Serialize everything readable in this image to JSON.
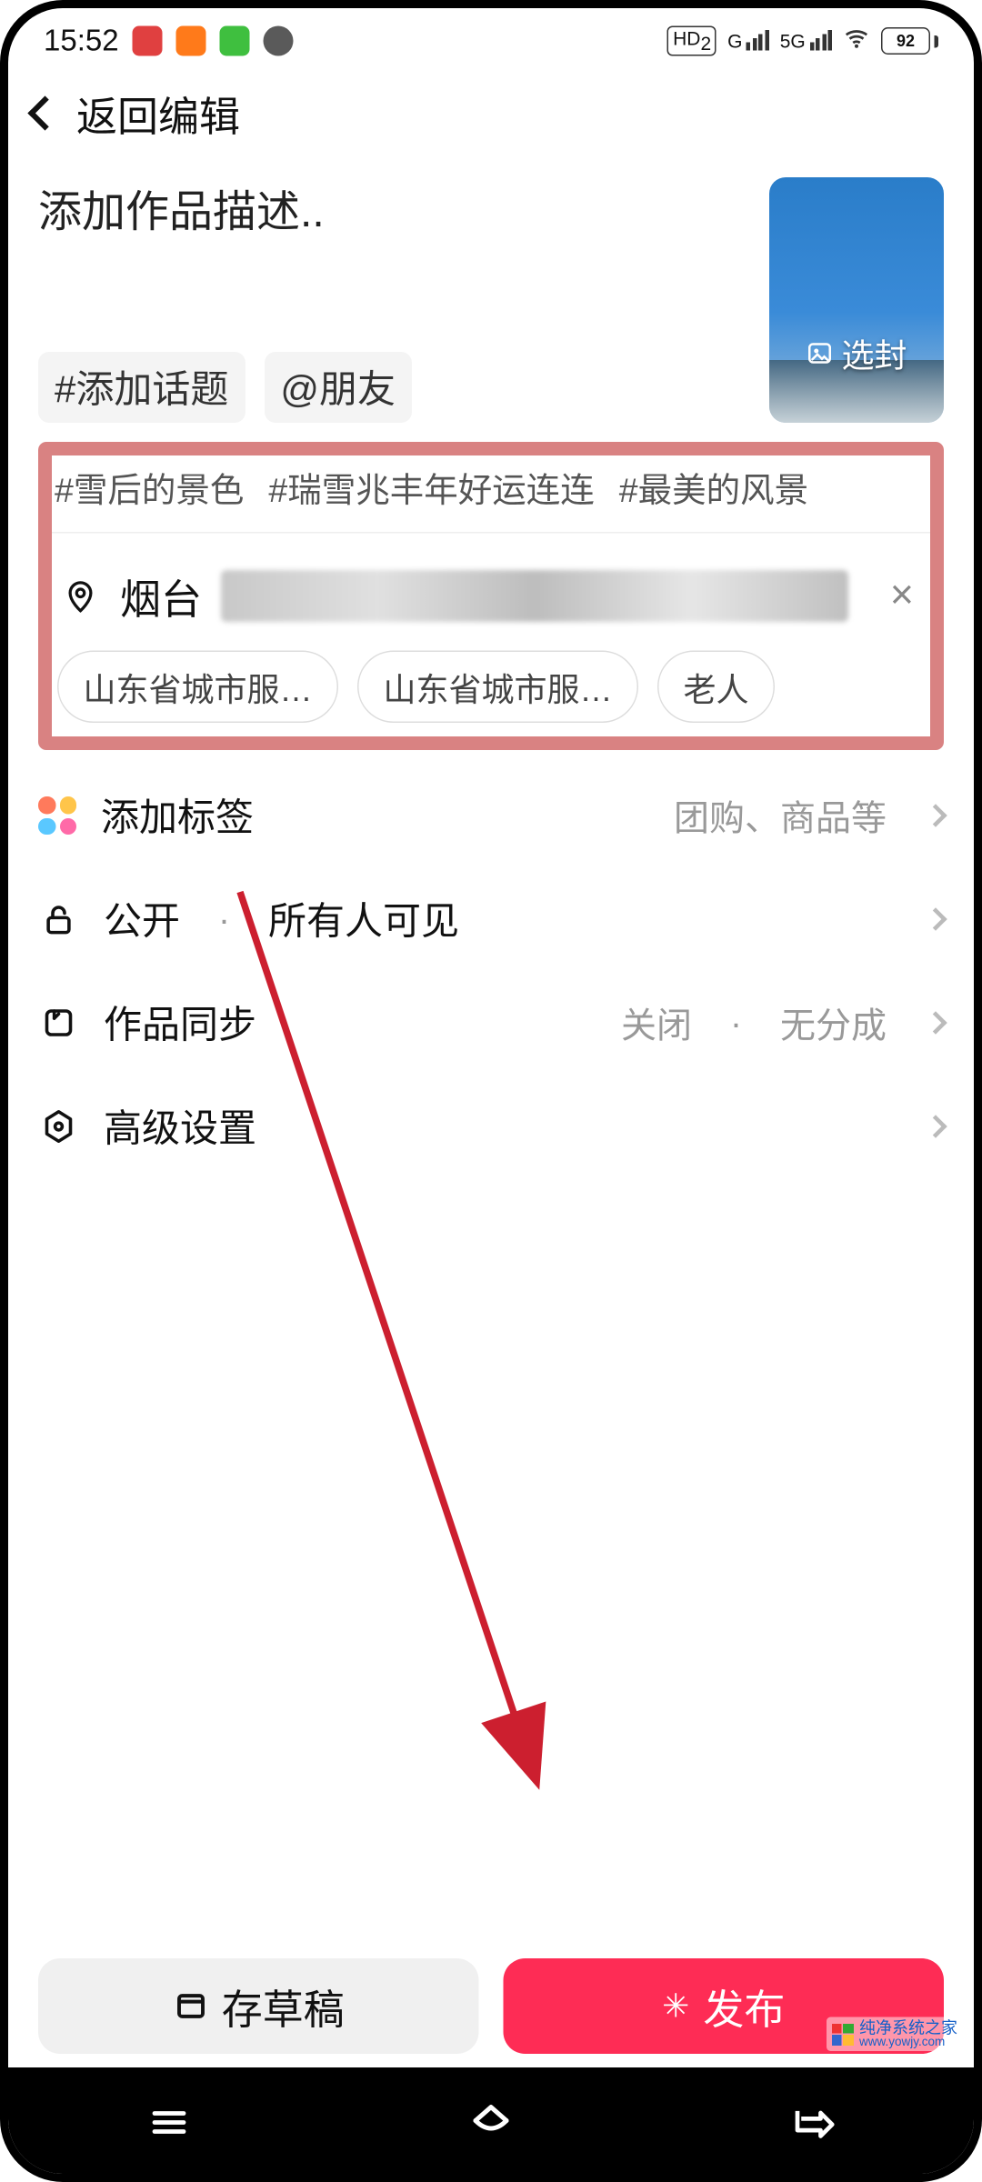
{
  "status_bar": {
    "time": "15:52",
    "hd_badge": "HD",
    "hd_sub": "2",
    "net1_label": "G",
    "net2_label": "5G",
    "battery_pct": "92"
  },
  "header": {
    "back_label": "返回编辑"
  },
  "compose": {
    "desc_placeholder": "添加作品描述..",
    "topic_chip": "#添加话题",
    "mention_chip": "@朋友",
    "cover_label": "选封"
  },
  "topics": [
    "#雪后的景色",
    "#瑞雪兆丰年好运连连",
    "#最美的风景"
  ],
  "location": {
    "name_visible": "烟台",
    "suggestions": [
      "山东省城市服…",
      "山东省城市服…",
      "老人"
    ]
  },
  "rows": {
    "tags": {
      "label": "添加标签",
      "value": "团购、商品等"
    },
    "privacy": {
      "label": "公开",
      "value": "所有人可见"
    },
    "sync": {
      "label": "作品同步",
      "value1": "关闭",
      "value2": "无分成"
    },
    "advanced": {
      "label": "高级设置"
    }
  },
  "bottom": {
    "draft": "存草稿",
    "publish": "发布"
  },
  "watermark": {
    "title": "纯净系统之家",
    "url": "www.yowjy.com"
  },
  "colors": {
    "accent": "#fe2c55",
    "highlight_border": "#d98282",
    "arrow": "#cc1f2f"
  }
}
